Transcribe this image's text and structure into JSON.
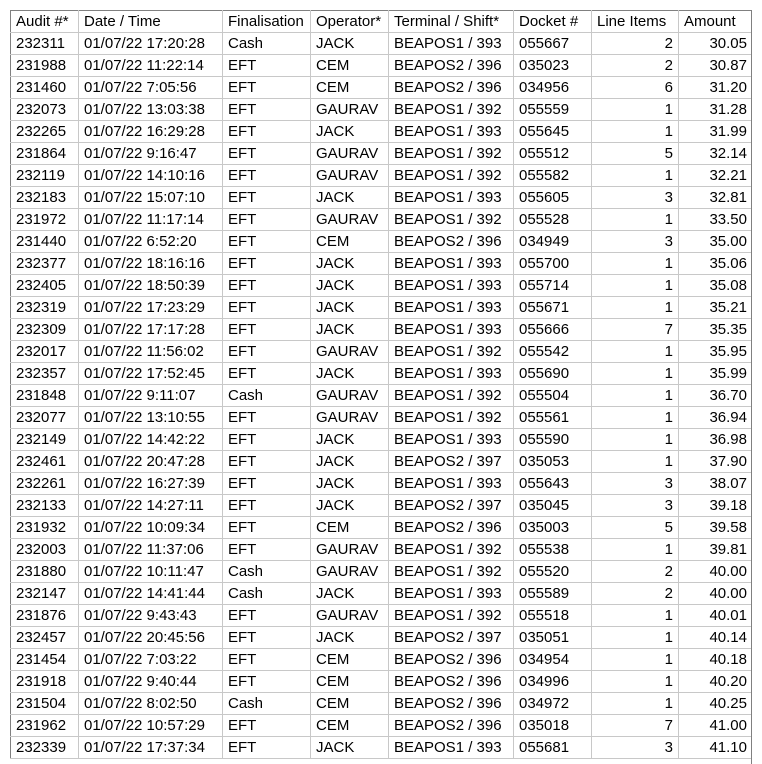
{
  "table": {
    "name": "audit-transactions-grid",
    "columns": [
      {
        "key": "audit",
        "label": "Audit #*",
        "align": "left"
      },
      {
        "key": "datetime",
        "label": "Date / Time",
        "align": "left"
      },
      {
        "key": "final",
        "label": "Finalisation",
        "align": "left"
      },
      {
        "key": "operator",
        "label": "Operator*",
        "align": "left"
      },
      {
        "key": "terminal",
        "label": "Terminal / Shift*",
        "align": "left"
      },
      {
        "key": "docket",
        "label": "Docket #",
        "align": "left"
      },
      {
        "key": "lineitems",
        "label": "Line Items",
        "align": "right"
      },
      {
        "key": "amount",
        "label": "Amount",
        "align": "right"
      }
    ],
    "rows": [
      [
        "232311",
        "01/07/22 17:20:28",
        "Cash",
        "JACK",
        "BEAPOS1 / 393",
        "055667",
        "2",
        "30.05"
      ],
      [
        "231988",
        "01/07/22 11:22:14",
        "EFT",
        "CEM",
        "BEAPOS2 / 396",
        "035023",
        "2",
        "30.87"
      ],
      [
        "231460",
        "01/07/22  7:05:56",
        "EFT",
        "CEM",
        "BEAPOS2 / 396",
        "034956",
        "6",
        "31.20"
      ],
      [
        "232073",
        "01/07/22 13:03:38",
        "EFT",
        "GAURAV",
        "BEAPOS1 / 392",
        "055559",
        "1",
        "31.28"
      ],
      [
        "232265",
        "01/07/22 16:29:28",
        "EFT",
        "JACK",
        "BEAPOS1 / 393",
        "055645",
        "1",
        "31.99"
      ],
      [
        "231864",
        "01/07/22  9:16:47",
        "EFT",
        "GAURAV",
        "BEAPOS1 / 392",
        "055512",
        "5",
        "32.14"
      ],
      [
        "232119",
        "01/07/22 14:10:16",
        "EFT",
        "GAURAV",
        "BEAPOS1 / 392",
        "055582",
        "1",
        "32.21"
      ],
      [
        "232183",
        "01/07/22 15:07:10",
        "EFT",
        "JACK",
        "BEAPOS1 / 393",
        "055605",
        "3",
        "32.81"
      ],
      [
        "231972",
        "01/07/22 11:17:14",
        "EFT",
        "GAURAV",
        "BEAPOS1 / 392",
        "055528",
        "1",
        "33.50"
      ],
      [
        "231440",
        "01/07/22  6:52:20",
        "EFT",
        "CEM",
        "BEAPOS2 / 396",
        "034949",
        "3",
        "35.00"
      ],
      [
        "232377",
        "01/07/22 18:16:16",
        "EFT",
        "JACK",
        "BEAPOS1 / 393",
        "055700",
        "1",
        "35.06"
      ],
      [
        "232405",
        "01/07/22 18:50:39",
        "EFT",
        "JACK",
        "BEAPOS1 / 393",
        "055714",
        "1",
        "35.08"
      ],
      [
        "232319",
        "01/07/22 17:23:29",
        "EFT",
        "JACK",
        "BEAPOS1 / 393",
        "055671",
        "1",
        "35.21"
      ],
      [
        "232309",
        "01/07/22 17:17:28",
        "EFT",
        "JACK",
        "BEAPOS1 / 393",
        "055666",
        "7",
        "35.35"
      ],
      [
        "232017",
        "01/07/22 11:56:02",
        "EFT",
        "GAURAV",
        "BEAPOS1 / 392",
        "055542",
        "1",
        "35.95"
      ],
      [
        "232357",
        "01/07/22 17:52:45",
        "EFT",
        "JACK",
        "BEAPOS1 / 393",
        "055690",
        "1",
        "35.99"
      ],
      [
        "231848",
        "01/07/22  9:11:07",
        "Cash",
        "GAURAV",
        "BEAPOS1 / 392",
        "055504",
        "1",
        "36.70"
      ],
      [
        "232077",
        "01/07/22 13:10:55",
        "EFT",
        "GAURAV",
        "BEAPOS1 / 392",
        "055561",
        "1",
        "36.94"
      ],
      [
        "232149",
        "01/07/22 14:42:22",
        "EFT",
        "JACK",
        "BEAPOS1 / 393",
        "055590",
        "1",
        "36.98"
      ],
      [
        "232461",
        "01/07/22 20:47:28",
        "EFT",
        "JACK",
        "BEAPOS2 / 397",
        "035053",
        "1",
        "37.90"
      ],
      [
        "232261",
        "01/07/22 16:27:39",
        "EFT",
        "JACK",
        "BEAPOS1 / 393",
        "055643",
        "3",
        "38.07"
      ],
      [
        "232133",
        "01/07/22 14:27:11",
        "EFT",
        "JACK",
        "BEAPOS2 / 397",
        "035045",
        "3",
        "39.18"
      ],
      [
        "231932",
        "01/07/22 10:09:34",
        "EFT",
        "CEM",
        "BEAPOS2 / 396",
        "035003",
        "5",
        "39.58"
      ],
      [
        "232003",
        "01/07/22 11:37:06",
        "EFT",
        "GAURAV",
        "BEAPOS1 / 392",
        "055538",
        "1",
        "39.81"
      ],
      [
        "231880",
        "01/07/22 10:11:47",
        "Cash",
        "GAURAV",
        "BEAPOS1 / 392",
        "055520",
        "2",
        "40.00"
      ],
      [
        "232147",
        "01/07/22 14:41:44",
        "Cash",
        "JACK",
        "BEAPOS1 / 393",
        "055589",
        "2",
        "40.00"
      ],
      [
        "231876",
        "01/07/22  9:43:43",
        "EFT",
        "GAURAV",
        "BEAPOS1 / 392",
        "055518",
        "1",
        "40.01"
      ],
      [
        "232457",
        "01/07/22 20:45:56",
        "EFT",
        "JACK",
        "BEAPOS2 / 397",
        "035051",
        "1",
        "40.14"
      ],
      [
        "231454",
        "01/07/22  7:03:22",
        "EFT",
        "CEM",
        "BEAPOS2 / 396",
        "034954",
        "1",
        "40.18"
      ],
      [
        "231918",
        "01/07/22  9:40:44",
        "EFT",
        "CEM",
        "BEAPOS2 / 396",
        "034996",
        "1",
        "40.20"
      ],
      [
        "231504",
        "01/07/22  8:02:50",
        "Cash",
        "CEM",
        "BEAPOS2 / 396",
        "034972",
        "1",
        "40.25"
      ],
      [
        "231962",
        "01/07/22 10:57:29",
        "EFT",
        "CEM",
        "BEAPOS2 / 396",
        "035018",
        "7",
        "41.00"
      ],
      [
        "232339",
        "01/07/22 17:37:34",
        "EFT",
        "JACK",
        "BEAPOS1 / 393",
        "055681",
        "3",
        "41.10"
      ]
    ]
  },
  "colors": {
    "grid_line": "#c8c8c8",
    "frame_line": "#808080",
    "background": "#ffffff",
    "text": "#000000"
  }
}
